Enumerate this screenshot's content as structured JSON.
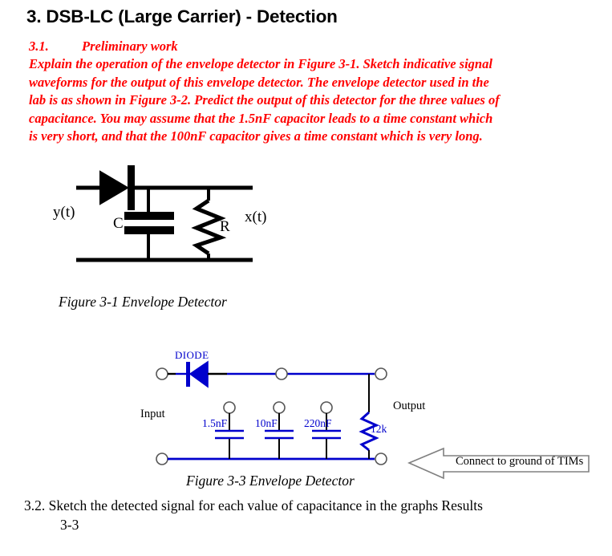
{
  "document": {
    "heading": "3. DSB-LC (Large Carrier) - Detection",
    "subsection": {
      "number": "3.1.",
      "title": "Preliminary work"
    },
    "preliminary_paragraph": {
      "lines": [
        "Explain the operation of the envelope detector in Figure 3-1.  Sketch indicative signal",
        "waveforms for the output of this envelope detector. The envelope detector used in the",
        "lab is as shown in Figure 3-2. Predict the output of this detector for the three values of",
        "capacitance. You may assume that the 1.5nF capacitor leads to a time constant which",
        "is very short, and that the 100nF capacitor gives a time constant which is very long."
      ],
      "color": "#FF0000"
    },
    "item_3_2": {
      "line1": "3.2. Sketch the detected signal for each value of capacitance in the graphs Results",
      "line2": "3-3"
    }
  },
  "figure_3_1": {
    "caption": "Figure 3-1 Envelope Detector",
    "labels": {
      "input_signal": "y(t)",
      "capacitor": "C",
      "resistor": "R",
      "output_signal": "x(t)"
    },
    "components": [
      "diode",
      "capacitor",
      "resistor"
    ],
    "color": "#000000"
  },
  "figure_3_3": {
    "caption": "Figure 3-3 Envelope Detector",
    "labels": {
      "diode": "DIODE",
      "input": "Input",
      "output": "Output",
      "capacitor_1": "1.5nF",
      "capacitor_2": "10nF",
      "capacitor_3": "220nF",
      "resistor": "12k"
    },
    "wire_color": "#0000CC",
    "lead_color": "#000000"
  },
  "callout": {
    "text": "Connect to ground of TIMs",
    "direction": "left",
    "border_color": "#808080"
  }
}
